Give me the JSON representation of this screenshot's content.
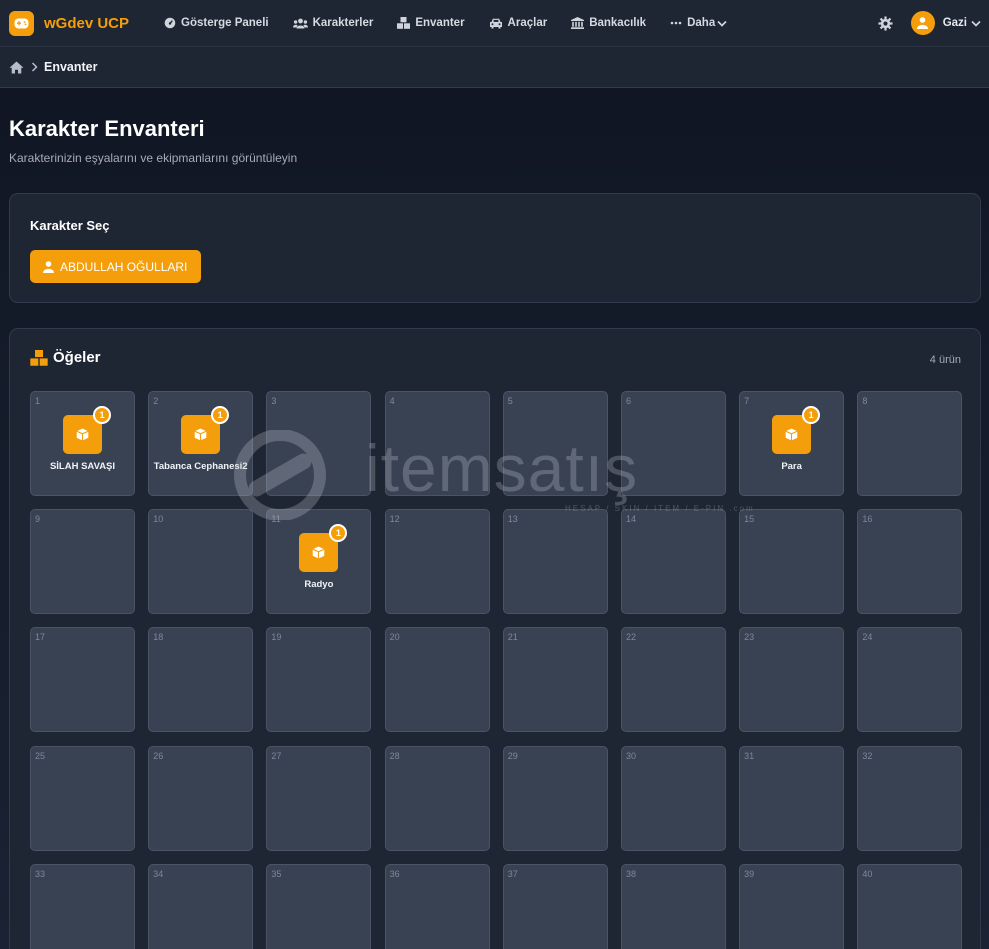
{
  "app": {
    "name": "wGdev UCP",
    "brand_color": "#f59e0b"
  },
  "nav": {
    "items": [
      {
        "label": "Gösterge Paneli",
        "icon": "gauge-icon"
      },
      {
        "label": "Karakterler",
        "icon": "users-icon"
      },
      {
        "label": "Envanter",
        "icon": "boxes-icon"
      },
      {
        "label": "Araçlar",
        "icon": "car-icon"
      },
      {
        "label": "Bankacılık",
        "icon": "bank-icon"
      },
      {
        "label": "Daha",
        "icon": "ellipsis-icon"
      }
    ],
    "user": {
      "name": "Gazi",
      "icon": "user-icon"
    },
    "settings_icon": "gear-icon"
  },
  "breadcrumb": {
    "home_icon": "home-icon",
    "current": "Envanter"
  },
  "header": {
    "title": "Karakter Envanteri",
    "subtitle": "Karakterinizin eşyalarını ve ekipmanlarını görüntüleyin"
  },
  "character_select": {
    "label": "Karakter Seç",
    "selected": "ABDULLAH OĞULLARI"
  },
  "inventory": {
    "title": "Öğeler",
    "count_label": "4 ürün",
    "slots": [
      {
        "num": "1",
        "item": "SİLAH SAVAŞI",
        "qty": "1"
      },
      {
        "num": "2",
        "item": "Tabanca Cephanesi2",
        "qty": "1"
      },
      {
        "num": "3"
      },
      {
        "num": "4"
      },
      {
        "num": "5"
      },
      {
        "num": "6"
      },
      {
        "num": "7",
        "item": "Para",
        "qty": "1"
      },
      {
        "num": "8"
      },
      {
        "num": "9"
      },
      {
        "num": "10"
      },
      {
        "num": "11",
        "item": "Radyo",
        "qty": "1"
      },
      {
        "num": "12"
      },
      {
        "num": "13"
      },
      {
        "num": "14"
      },
      {
        "num": "15"
      },
      {
        "num": "16"
      },
      {
        "num": "17"
      },
      {
        "num": "18"
      },
      {
        "num": "19"
      },
      {
        "num": "20"
      },
      {
        "num": "21"
      },
      {
        "num": "22"
      },
      {
        "num": "23"
      },
      {
        "num": "24"
      },
      {
        "num": "25"
      },
      {
        "num": "26"
      },
      {
        "num": "27"
      },
      {
        "num": "28"
      },
      {
        "num": "29"
      },
      {
        "num": "30"
      },
      {
        "num": "31"
      },
      {
        "num": "32"
      },
      {
        "num": "33"
      },
      {
        "num": "34"
      },
      {
        "num": "35"
      },
      {
        "num": "36"
      },
      {
        "num": "37"
      },
      {
        "num": "38"
      },
      {
        "num": "39"
      },
      {
        "num": "40"
      }
    ]
  },
  "watermark": {
    "text": "itemsatış",
    "sub": "HESAP / SKIN / ITEM / E-PIN .com"
  }
}
